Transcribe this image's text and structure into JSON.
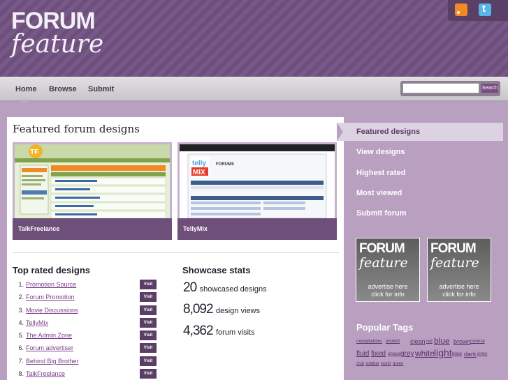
{
  "brand": {
    "logo_top": "FORUM",
    "logo_bottom": "feature",
    "accent": "#6e4f7a"
  },
  "nav": {
    "home": "Home",
    "browse": "Browse",
    "submit": "Submit",
    "search_button": "Search",
    "search_placeholder": ""
  },
  "social": {
    "rss_icon": "rss-icon",
    "twitter_icon": "twitter-icon"
  },
  "featured": {
    "title": "Featured forum designs",
    "cards": [
      {
        "label": "TalkFreelance"
      },
      {
        "label": "TellyMix"
      }
    ],
    "tellymix_logo_top": "telly",
    "tellymix_logo_bottom": "MIX",
    "tellymix_forums": "FORUMS",
    "talkfreelance_logo": "TF"
  },
  "top_rated": {
    "title": "Top rated designs",
    "visit_label": "Visit",
    "items": [
      {
        "num": "1.",
        "name": "Promotion Source"
      },
      {
        "num": "2.",
        "name": "Forum Promotion"
      },
      {
        "num": "3.",
        "name": "Movie Discussions"
      },
      {
        "num": "4.",
        "name": "TellyMix"
      },
      {
        "num": "5.",
        "name": "The Admin Zone"
      },
      {
        "num": "6.",
        "name": "Forum advertiser"
      },
      {
        "num": "7.",
        "name": "Behind Big Brother"
      },
      {
        "num": "8.",
        "name": "TalkFreelance"
      }
    ]
  },
  "stats": {
    "title": "Showcase stats",
    "items": [
      {
        "num": "20",
        "label": "showcased designs"
      },
      {
        "num": "8,092",
        "label": "design views"
      },
      {
        "num": "4,362",
        "label": "forum visits"
      }
    ]
  },
  "sidebar": {
    "menu": [
      "Featured designs",
      "View designs",
      "Highest rated",
      "Most viewed",
      "Submit forum"
    ],
    "ad": {
      "forum": "FORUM",
      "feature": "feature",
      "line1": "advertise here",
      "line2": "click for info"
    },
    "tags_title": "Popular Tags",
    "tags": [
      "mixingbubbes",
      "phpbb3",
      "clean",
      "red",
      "blue",
      "brown",
      "minimal",
      "fluid",
      "fixed",
      "unique",
      "grey",
      "white",
      "light",
      "black",
      "dark",
      "ioney",
      "club",
      "sidebar",
      "world",
      "green"
    ]
  }
}
